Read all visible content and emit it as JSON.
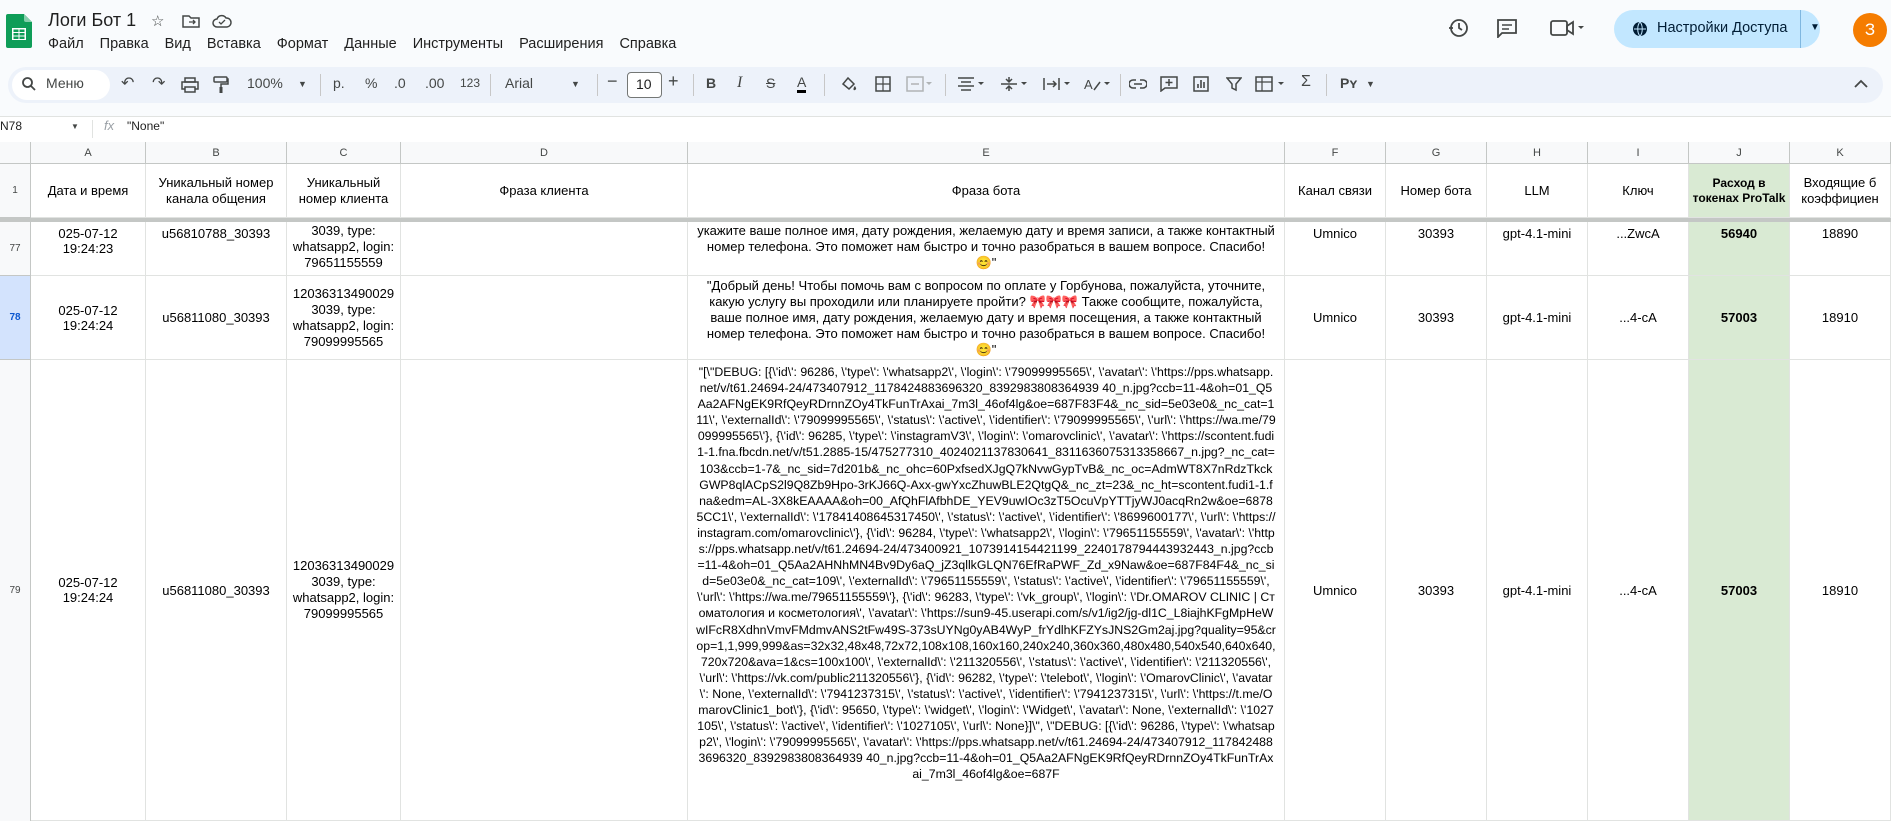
{
  "app": {
    "title": "Логи Бот 1",
    "menu": [
      "Файл",
      "Правка",
      "Вид",
      "Вставка",
      "Формат",
      "Данные",
      "Инструменты",
      "Расширения",
      "Справка"
    ],
    "share_label": "Настройки Доступа",
    "avatar_letter": "З"
  },
  "toolbar": {
    "search_placeholder": "Меню",
    "zoom": "100%",
    "currency": "р.",
    "percent": "%",
    "dec_decrease": ".0",
    "dec_increase": ".00",
    "number_format": "123",
    "font": "Arial",
    "font_size": "10"
  },
  "formula_bar": {
    "cell_ref": "N78",
    "fx": "fx",
    "value": "\"None\""
  },
  "columns": [
    "A",
    "B",
    "C",
    "D",
    "E",
    "F",
    "G",
    "H",
    "I",
    "J",
    "K"
  ],
  "header_row": {
    "row_num": "1",
    "cells": [
      "Дата и время",
      "Уникальный номер канала общения",
      "Уникальный номер клиента",
      "Фраза клиента",
      "Фраза бота",
      "Канал связи",
      "Номер бота",
      "LLM",
      "Ключ",
      "Расход в токенах ProTalk",
      "Входящие б коэффициен"
    ]
  },
  "rows": [
    {
      "num": "77",
      "cells": [
        "025-07-12 19:24:23",
        "u56810788_30393",
        "3039, type: whatsapp2, login: 79651155559",
        "",
        "укажите ваше полное имя, дату рождения, желаемую дату и время записи, а также контактный номер телефона. Это поможет нам быстро и точно разобраться в вашем вопросе. Спасибо! 😊\"",
        "Umnico",
        "30393",
        "gpt-4.1-mini",
        "...ZwcA",
        "56940",
        "18890"
      ]
    },
    {
      "num": "78",
      "cells": [
        "025-07-12 19:24:24",
        "u56811080_30393",
        "12036313490029 3039, type: whatsapp2, login: 79099995565",
        "",
        "\"Добрый день! Чтобы помочь вам с вопросом по оплате у Горбунова, пожалуйста, уточните, какую услугу вы проходили или планируете пройти? 🎀🎀🎀 Также сообщите, пожалуйста, ваше полное имя, дату рождения, желаемую дату и время посещения, а также контактный номер телефона. Это поможет нам быстро и точно разобраться в вашем вопросе. Спасибо! 😊\"",
        "Umnico",
        "30393",
        "gpt-4.1-mini",
        "...4-cA",
        "57003",
        "18910"
      ]
    },
    {
      "num": "79",
      "cells": [
        "025-07-12 19:24:24",
        "u56811080_30393",
        "12036313490029 3039, type: whatsapp2, login: 79099995565",
        "",
        "\"[\\\"DEBUG: [{\\'id\\': 96286, \\'type\\': \\'whatsapp2\\', \\'login\\': \\'79099995565\\', \\'avatar\\': \\'https://pps.whatsapp.net/v/t61.24694-24/473407912_1178424883696320_8392983808364939 40_n.jpg?ccb=11-4&oh=01_Q5Aa2AFNgEK9RfQeyRDrnnZOy4TkFunTrAxai_7m3l_46of4lg&oe=687F83F4&_nc_sid=5e03e0&_nc_cat=111\\', \\'externalId\\': \\'79099995565\\', \\'status\\': \\'active\\', \\'identifier\\': \\'79099995565\\', \\'url\\': \\'https://wa.me/79099995565\\'}, {\\'id\\': 96285, \\'type\\': \\'instagramV3\\', \\'login\\': \\'omarovclinic\\', \\'avatar\\': \\'https://scontent.fudi1-1.fna.fbcdn.net/v/t51.2885-15/475277310_4024021137830641_8311636075313358667_n.jpg?_nc_cat=103&ccb=1-7&_nc_sid=7d201b&_nc_ohc=60PxfsedXJgQ7kNvwGypTvB&_nc_oc=AdmWT8X7nRdzTkckGWP8qlACpS2l9Q8Zb9Hpo-3rKJ66Q-Axx-gwYxcZhuwBLE2QtgQ&_nc_zt=23&_nc_ht=scontent.fudi1-1.fna&edm=AL-3X8kEAAAA&oh=00_AfQhFlAfbhDE_YEV9uwIOc3zT5OcuVpYTTjyWJ0acqRn2w&oe=68785CC1\\', \\'externalId\\': \\'17841408645317450\\', \\'status\\': \\'active\\', \\'identifier\\': \\'8699600177\\', \\'url\\': \\'https://instagram.com/omarovclinic\\'}, {\\'id\\': 96284, \\'type\\': \\'whatsapp2\\', \\'login\\': \\'79651155559\\', \\'avatar\\': \\'https://pps.whatsapp.net/v/t61.24694-24/473400921_1073914154421199_2240178794443932443_n.jpg?ccb=11-4&oh=01_Q5Aa2AHNhMN4Bv9Dy6aQ_jZ3qllkGLQN76EfRaPWF_Zd_x9Naw&oe=687F84F4&_nc_sid=5e03e0&_nc_cat=109\\', \\'externalId\\': \\'79651155559\\', \\'status\\': \\'active\\', \\'identifier\\': \\'79651155559\\', \\'url\\': \\'https://wa.me/79651155559\\'}, {\\'id\\': 96283, \\'type\\': \\'vk_group\\', \\'login\\': \\'Dr.OMAROV CLINIC | Стоматология и косметология\\', \\'avatar\\': \\'https://sun9-45.userapi.com/s/v1/ig2/jg-dl1C_L8iajhKFgMpHeWwIFcR8XdhnVmvFMdmvANS2tFw49S-373sUYNg0yAB4WyP_frYdlhKFZYsJNS2Gm2aj.jpg?quality=95&crop=1,1,999,999&as=32x32,48x48,72x72,108x108,160x160,240x240,360x360,480x480,540x540,640x640,720x720&ava=1&cs=100x100\\', \\'externalId\\': \\'211320556\\', \\'status\\': \\'active\\', \\'identifier\\': \\'211320556\\', \\'url\\': \\'https://vk.com/public211320556\\'}, {\\'id\\': 96282, \\'type\\': \\'telebot\\', \\'login\\': \\'OmarovClinic\\', \\'avatar\\': None, \\'externalId\\': \\'7941237315\\', \\'status\\': \\'active\\', \\'identifier\\': \\'7941237315\\', \\'url\\': \\'https://t.me/OmarovClinic1_bot\\'}, {\\'id\\': 95650, \\'type\\': \\'widget\\', \\'login\\': \\'Widget\\', \\'avatar\\': None, \\'externalId\\': \\'1027105\\', \\'status\\': \\'active\\', \\'identifier\\': \\'1027105\\', \\'url\\': None}]\\\", \\\"DEBUG: [{\\'id\\': 96286, \\'type\\': \\'whatsapp2\\', \\'login\\': \\'79099995565\\', \\'avatar\\': \\'https://pps.whatsapp.net/v/t61.24694-24/473407912_1178424883696320_8392983808364939 40_n.jpg?ccb=11-4&oh=01_Q5Aa2AFNgEK9RfQeyRDrnnZOy4TkFunTrAxai_7m3l_46of4lg&oe=687F",
        "Umnico",
        "30393",
        "gpt-4.1-mini",
        "...4-cA",
        "57003",
        "18910"
      ]
    }
  ],
  "colors": {
    "share_bg": "#c2e7ff",
    "avatar_bg": "#f57c00",
    "green_col": "#d9ead3",
    "selected_row": "#d3e3fd"
  }
}
